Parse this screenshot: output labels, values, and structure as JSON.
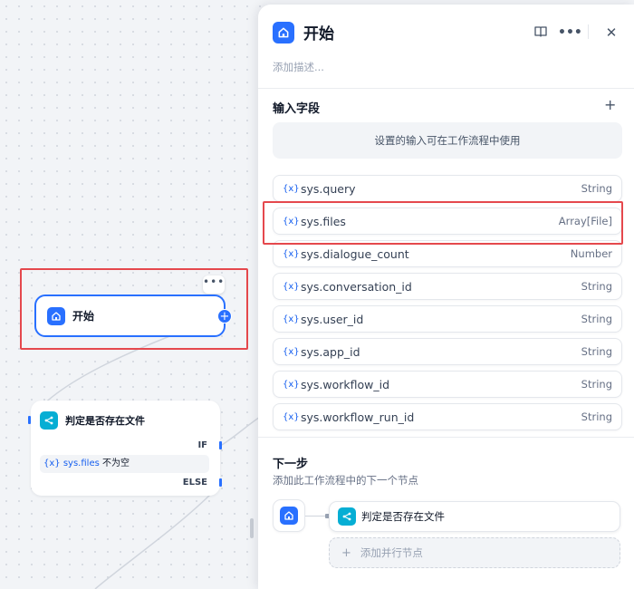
{
  "canvas": {
    "more_menu": "•••",
    "start_node": {
      "label": "开始",
      "icon": "home-icon"
    },
    "ifelse_node": {
      "title": "判定是否存在文件",
      "icon": "branch-icon",
      "if_label": "IF",
      "condition": {
        "var_icon": "{x}",
        "variable": "sys.files",
        "operator": "不为空"
      },
      "else_label": "ELSE"
    }
  },
  "panel": {
    "title": "开始",
    "icon": "home-icon",
    "header_icons": [
      "book-icon",
      "more-icon",
      "close-icon"
    ],
    "description_placeholder": "添加描述...",
    "input_section": {
      "title": "输入字段",
      "hint": "设置的输入可在工作流程中使用",
      "fields": [
        {
          "name": "sys.query",
          "type": "String"
        },
        {
          "name": "sys.files",
          "type": "Array[File]"
        },
        {
          "name": "sys.dialogue_count",
          "type": "Number"
        },
        {
          "name": "sys.conversation_id",
          "type": "String"
        },
        {
          "name": "sys.user_id",
          "type": "String"
        },
        {
          "name": "sys.app_id",
          "type": "String"
        },
        {
          "name": "sys.workflow_id",
          "type": "String"
        },
        {
          "name": "sys.workflow_run_id",
          "type": "String"
        }
      ],
      "var_icon": "{x}"
    },
    "next_step": {
      "title": "下一步",
      "description": "添加此工作流程中的下一个节点",
      "next_node": "判定是否存在文件",
      "add_parallel": "添加并行节点"
    }
  },
  "colors": {
    "accent": "#2970ff",
    "highlight": "#e5484d",
    "teal": "#06aed4"
  }
}
